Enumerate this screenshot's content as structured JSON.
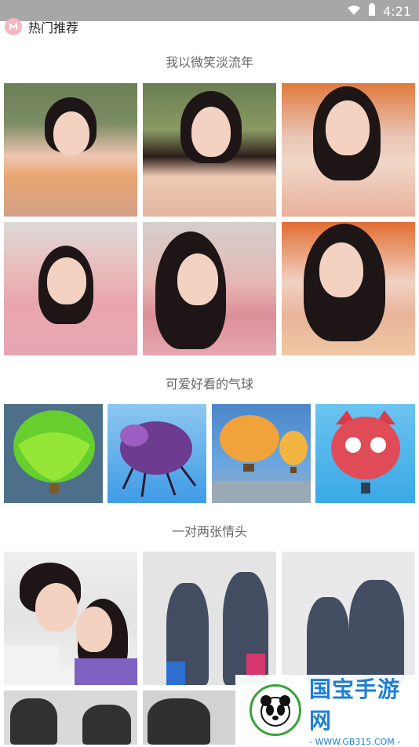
{
  "status_bar": {
    "time": "4:21",
    "icons": [
      "wifi-icon",
      "battery-icon"
    ]
  },
  "header": {
    "title": "热门推荐",
    "logo_icon": "app-logo-icon"
  },
  "sections": [
    {
      "title": "我以微笑淡流年"
    },
    {
      "title": "可爱好看的气球"
    },
    {
      "title": "一对两张情头"
    }
  ],
  "watermark": {
    "cn": "国宝手游网",
    "url": "- WWW.GB315.COM -",
    "logo_icon": "panda-icon"
  }
}
